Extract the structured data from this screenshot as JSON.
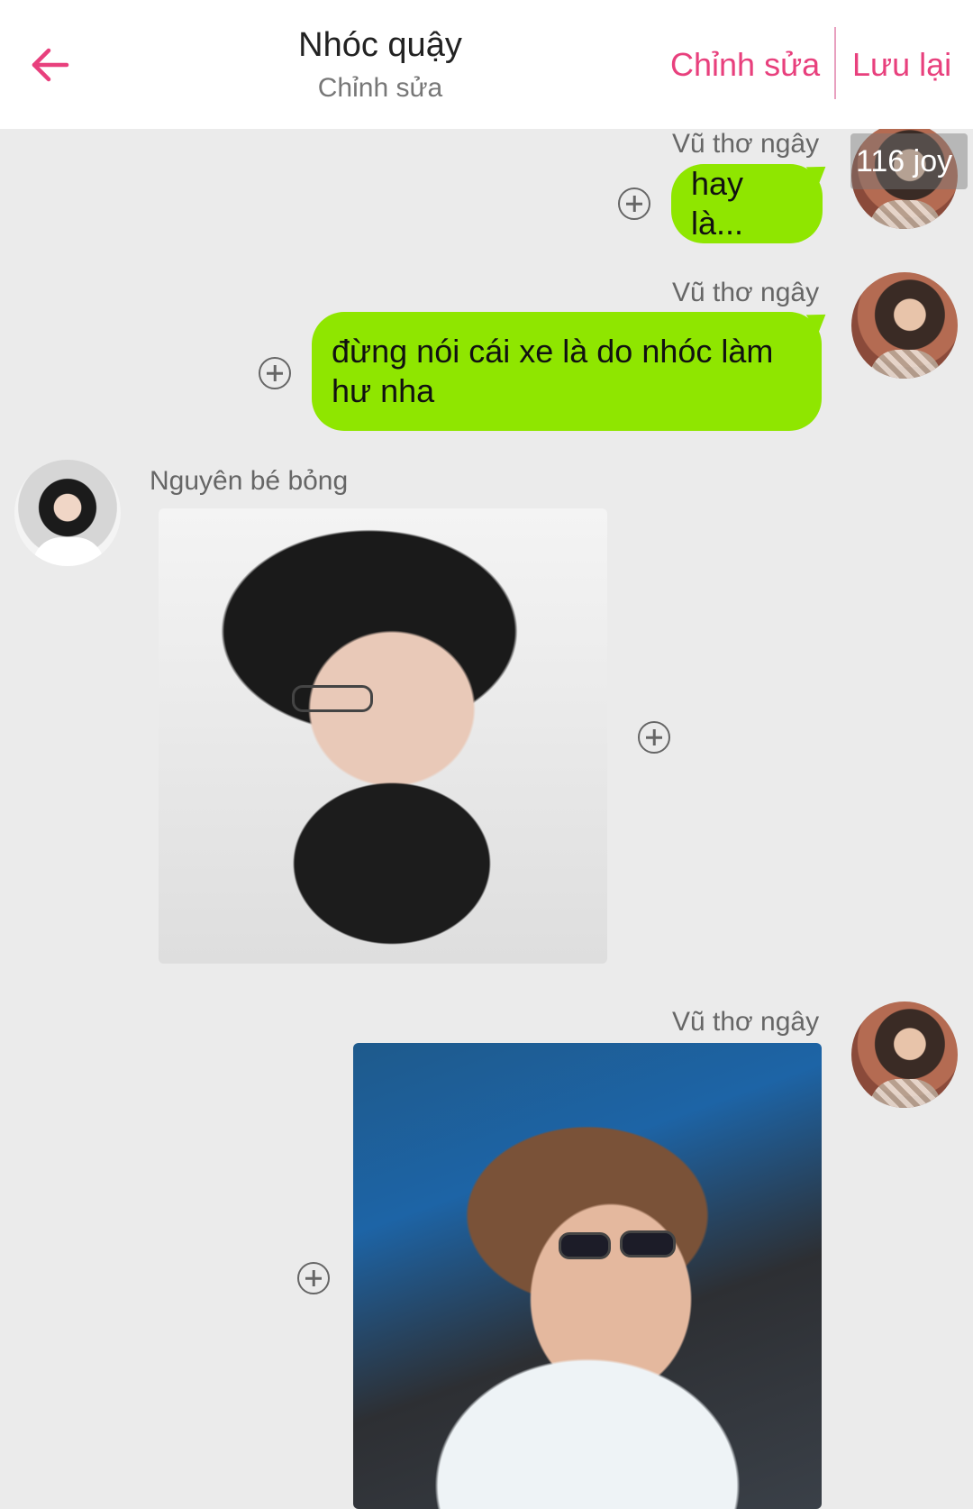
{
  "header": {
    "title": "Nhóc quậy",
    "subtitle": "Chỉnh sửa",
    "edit_label": "Chỉnh sửa",
    "save_label": "Lưu lại",
    "accent_color": "#e8407d",
    "back_icon": "arrow-left-icon"
  },
  "messages": [
    {
      "sender": "Vũ thơ ngây",
      "type": "text",
      "text": "hay là...",
      "side": "right"
    },
    {
      "sender": "Vũ thơ ngây",
      "type": "text",
      "text": "đừng nói cái xe là do nhóc làm hư nha",
      "side": "right"
    },
    {
      "sender": "Nguyên bé bỏng",
      "type": "image",
      "side": "left"
    },
    {
      "sender": "Vũ thơ ngây",
      "type": "image",
      "side": "right"
    }
  ],
  "overlay": {
    "tag": "116 joy"
  },
  "colors": {
    "bubble": "#8fe600",
    "background": "#ebebeb"
  }
}
